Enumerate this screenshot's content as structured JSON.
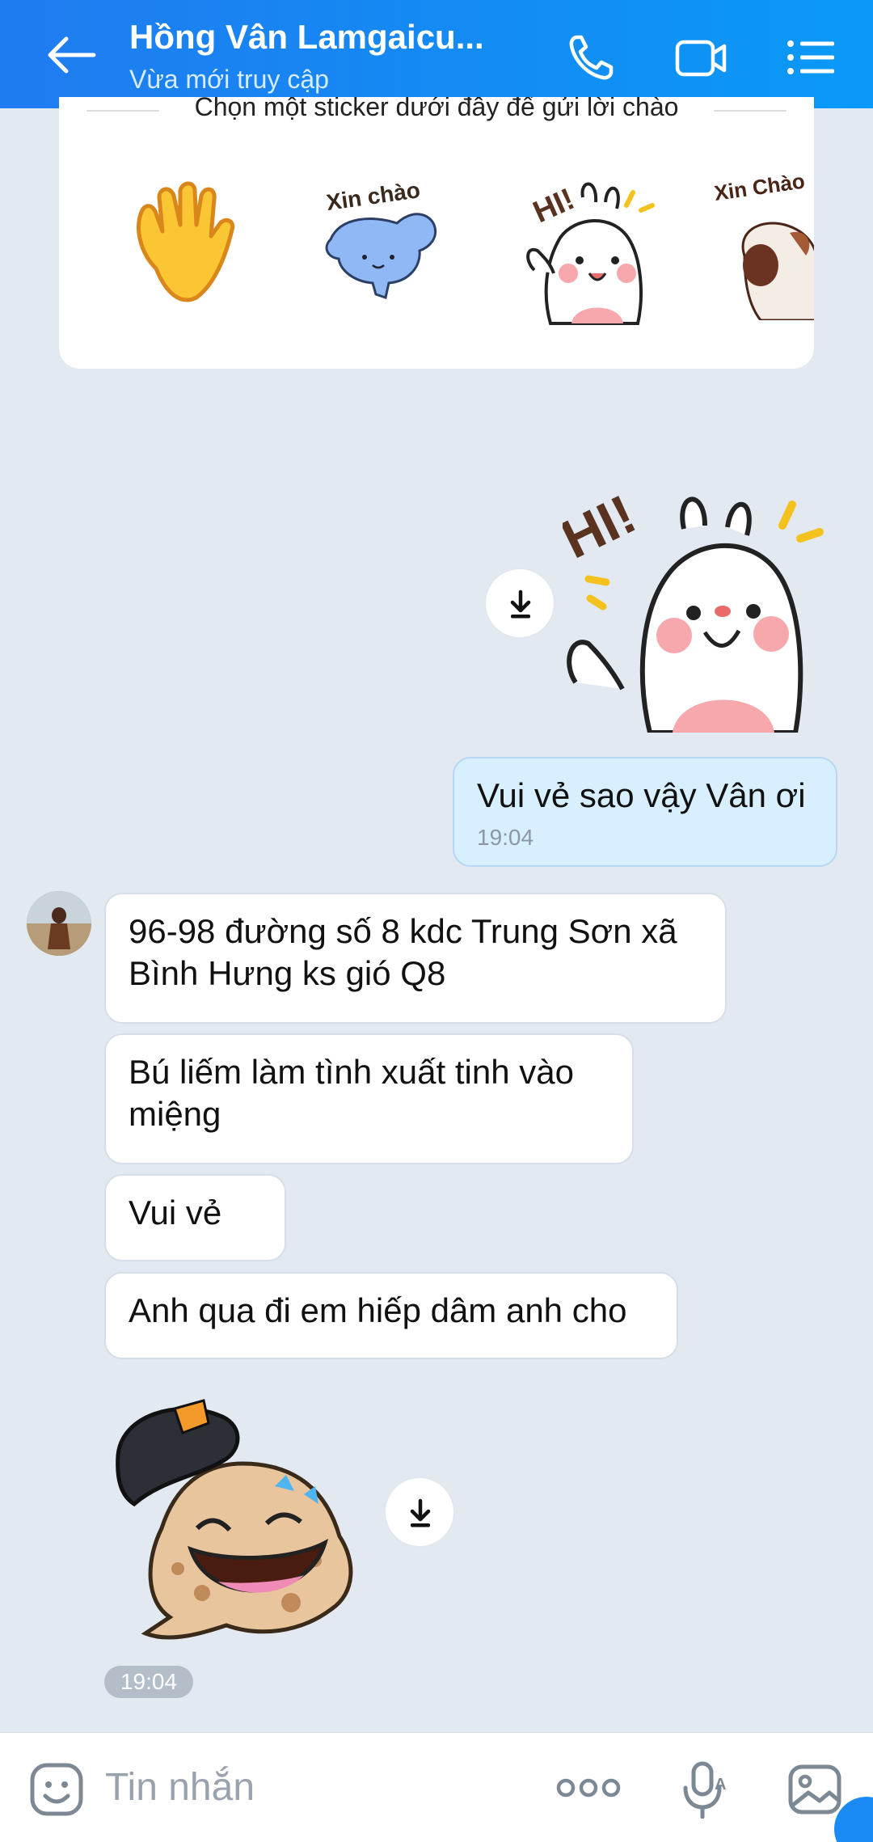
{
  "header": {
    "title": "Hồng Vân Lamgaicu...",
    "subtitle": "Vừa mới truy cập"
  },
  "suggestion": {
    "text": "Chọn một sticker dưới đây để gửi lời chào",
    "stickers": [
      "waving-hand",
      "blue-cat-xin-chao",
      "bunny-hi",
      "dog-xin-chao"
    ],
    "sticker_labels": {
      "cat": "Xin chào",
      "bunny": "HI!",
      "dog": "Xin Chào"
    }
  },
  "messages": {
    "sent_sticker_label": "HI!",
    "sent_text": "Vui vẻ sao vậy Vân ơi",
    "sent_time": "19:04",
    "recv_1": "96-98 đường số 8 kdc Trung Sơn xã Bình Hưng ks gió Q8",
    "recv_2": "Bú liếm làm tình xuất tinh vào miệng",
    "recv_3": "Vui vẻ",
    "recv_4": "Anh qua đi em hiếp dâm anh cho",
    "recv_sticker_time": "19:04"
  },
  "input": {
    "placeholder": "Tin nhắn"
  },
  "colors": {
    "header_start": "#1f7bf0",
    "header_end": "#0a99f6",
    "background": "#e2e9f1",
    "sent_bubble": "#d8efff"
  }
}
